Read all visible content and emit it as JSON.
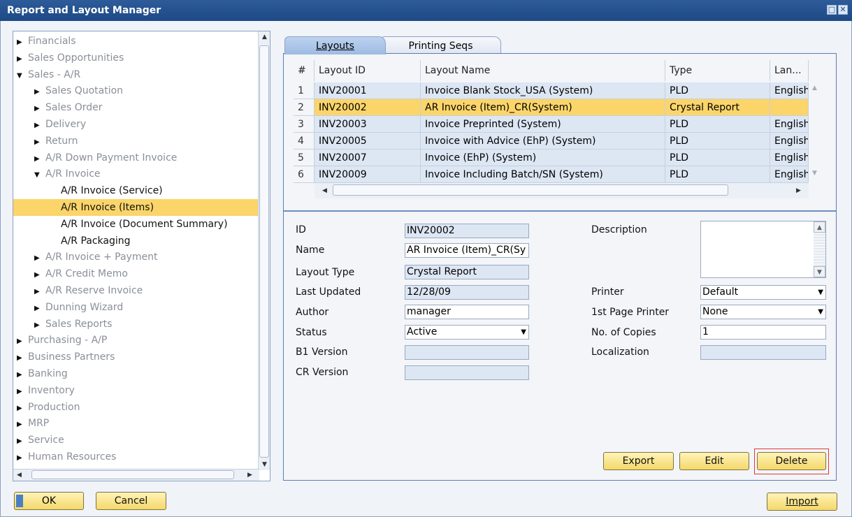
{
  "window": {
    "title": "Report and Layout Manager"
  },
  "tree": {
    "items": [
      {
        "label": "Financials",
        "arrow": "▶",
        "level": 0,
        "enabled": false
      },
      {
        "label": "Sales Opportunities",
        "arrow": "▶",
        "level": 0,
        "enabled": false
      },
      {
        "label": "Sales - A/R",
        "arrow": "▼",
        "level": 0,
        "enabled": false
      },
      {
        "label": "Sales Quotation",
        "arrow": "▶",
        "level": 1,
        "enabled": false
      },
      {
        "label": "Sales Order",
        "arrow": "▶",
        "level": 1,
        "enabled": false
      },
      {
        "label": "Delivery",
        "arrow": "▶",
        "level": 1,
        "enabled": false
      },
      {
        "label": "Return",
        "arrow": "▶",
        "level": 1,
        "enabled": false
      },
      {
        "label": "A/R Down Payment Invoice",
        "arrow": "▶",
        "level": 1,
        "enabled": false
      },
      {
        "label": "A/R Invoice",
        "arrow": "▼",
        "level": 1,
        "enabled": false
      },
      {
        "label": "A/R Invoice (Service)",
        "arrow": "",
        "level": 2,
        "enabled": true
      },
      {
        "label": "A/R Invoice (Items)",
        "arrow": "",
        "level": 2,
        "enabled": true,
        "selected": true
      },
      {
        "label": "A/R Invoice (Document Summary)",
        "arrow": "",
        "level": 2,
        "enabled": true
      },
      {
        "label": "A/R Packaging",
        "arrow": "",
        "level": 2,
        "enabled": true
      },
      {
        "label": "A/R Invoice + Payment",
        "arrow": "▶",
        "level": 1,
        "enabled": false
      },
      {
        "label": "A/R Credit Memo",
        "arrow": "▶",
        "level": 1,
        "enabled": false
      },
      {
        "label": "A/R Reserve Invoice",
        "arrow": "▶",
        "level": 1,
        "enabled": false
      },
      {
        "label": "Dunning Wizard",
        "arrow": "▶",
        "level": 1,
        "enabled": false
      },
      {
        "label": "Sales Reports",
        "arrow": "▶",
        "level": 1,
        "enabled": false
      },
      {
        "label": "Purchasing - A/P",
        "arrow": "▶",
        "level": 0,
        "enabled": false
      },
      {
        "label": "Business Partners",
        "arrow": "▶",
        "level": 0,
        "enabled": false
      },
      {
        "label": "Banking",
        "arrow": "▶",
        "level": 0,
        "enabled": false
      },
      {
        "label": "Inventory",
        "arrow": "▶",
        "level": 0,
        "enabled": false
      },
      {
        "label": "Production",
        "arrow": "▶",
        "level": 0,
        "enabled": false
      },
      {
        "label": "MRP",
        "arrow": "▶",
        "level": 0,
        "enabled": false
      },
      {
        "label": "Service",
        "arrow": "▶",
        "level": 0,
        "enabled": false
      },
      {
        "label": "Human Resources",
        "arrow": "▶",
        "level": 0,
        "enabled": false
      }
    ]
  },
  "tabs": [
    {
      "label": "Layouts",
      "active": true
    },
    {
      "label": "Printing Seqs",
      "active": false
    }
  ],
  "grid": {
    "headers": [
      "#",
      "Layout ID",
      "Layout Name",
      "Type",
      "Lan..."
    ],
    "rows": [
      {
        "num": "1",
        "id": "INV20001",
        "name": "Invoice Blank Stock_USA (System)",
        "type": "PLD",
        "lang": "English"
      },
      {
        "num": "2",
        "id": "INV20002",
        "name": "AR Invoice (Item)_CR(System)",
        "type": "Crystal Report",
        "lang": "",
        "selected": true
      },
      {
        "num": "3",
        "id": "INV20003",
        "name": "Invoice Preprinted (System)",
        "type": "PLD",
        "lang": "English"
      },
      {
        "num": "4",
        "id": "INV20005",
        "name": "Invoice with Advice (EhP) (System)",
        "type": "PLD",
        "lang": "English"
      },
      {
        "num": "5",
        "id": "INV20007",
        "name": "Invoice (EhP) (System)",
        "type": "PLD",
        "lang": "English"
      },
      {
        "num": "6",
        "id": "INV20009",
        "name": "Invoice Including Batch/SN (System)",
        "type": "PLD",
        "lang": "English"
      }
    ]
  },
  "details": {
    "id_label": "ID",
    "id_value": "INV20002",
    "name_label": "Name",
    "name_value": "AR Invoice (Item)_CR(Sy",
    "layout_type_label": "Layout Type",
    "layout_type_value": "Crystal Report",
    "last_updated_label": "Last Updated",
    "last_updated_value": "12/28/09",
    "author_label": "Author",
    "author_value": "manager",
    "status_label": "Status",
    "status_value": "Active",
    "b1_version_label": "B1 Version",
    "b1_version_value": "",
    "cr_version_label": "CR Version",
    "cr_version_value": "",
    "description_label": "Description",
    "description_value": "",
    "printer_label": "Printer",
    "printer_value": "Default",
    "first_page_printer_label": "1st Page Printer",
    "first_page_printer_value": "None",
    "copies_label": "No. of Copies",
    "copies_value": "1",
    "localization_label": "Localization",
    "localization_value": ""
  },
  "buttons": {
    "export": "Export",
    "edit": "Edit",
    "delete": "Delete",
    "ok": "OK",
    "cancel": "Cancel",
    "import": "Import"
  }
}
